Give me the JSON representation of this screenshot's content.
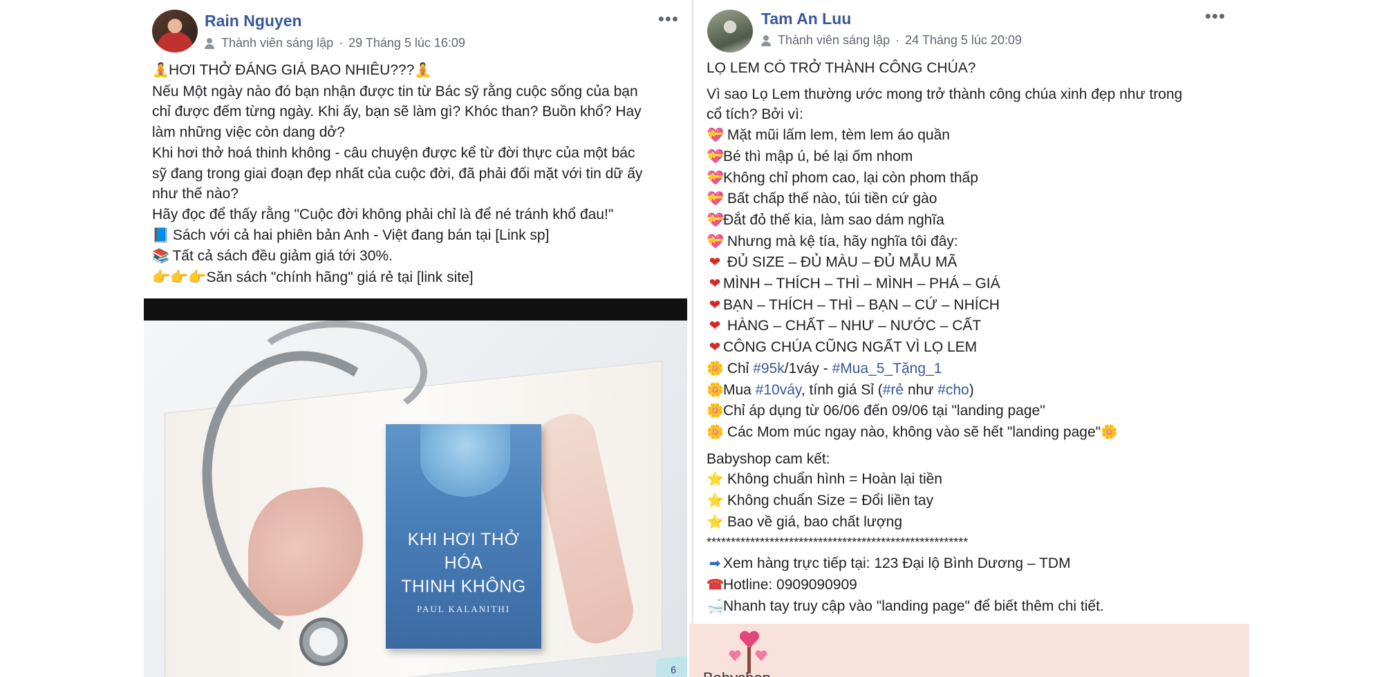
{
  "post1": {
    "author": "Rain Nguyen",
    "role": "Thành viên sáng lập",
    "separator": "·",
    "time": "29 Tháng 5 lúc 16:09",
    "more": "•••",
    "lines": [
      {
        "emoji_left": "🧘",
        "text": "HƠI THỞ ĐÁNG GIÁ BAO NHIÊU???",
        "emoji_right": "🧘"
      },
      {
        "text": "Nếu Một ngày nào đó bạn nhận được tin từ Bác sỹ rằng cuộc sống của bạn"
      },
      {
        "text": "chỉ được đếm từng ngày. Khi ấy, bạn sẽ làm gì? Khóc than? Buồn khổ? Hay"
      },
      {
        "text": "làm những việc còn dang dở?"
      },
      {
        "text": "Khi hơi thở hoá thinh không - câu chuyện được kể từ đời thực của một bác"
      },
      {
        "text": "sỹ đang trong giai đoạn đẹp nhất của cuộc đời, đã phải đối mặt với tin dữ ấy"
      },
      {
        "text": "như thế nào?"
      },
      {
        "text": "Hãy đọc để thấy rằng \"Cuộc đời không phải chỉ là để né tránh khổ đau!\""
      },
      {
        "emoji_left": "📘",
        "text": " Sách với cả hai phiên bản Anh - Việt đang bán tại [Link sp]"
      },
      {
        "emoji_left": "📚",
        "text": " Tất cả sách đều giảm giá tới 30%."
      },
      {
        "emoji_left": "👉👉👉",
        "text": "Săn sách \"chính hãng\" giá rẻ tại [link site]"
      }
    ],
    "image": {
      "book_title_lines": [
        "KHI HƠI THỞ",
        "HÓA",
        "THINH KHÔNG"
      ],
      "book_author": "PAUL KALANITHI",
      "tab_number": "6"
    }
  },
  "post2": {
    "author": "Tam An Luu",
    "role": "Thành viên sáng lập",
    "separator": "·",
    "time": "24 Tháng 5 lúc 20:09",
    "more": "•••",
    "title": "LỌ LEM CÓ TRỞ THÀNH CÔNG CHÚA?",
    "intro_1": "Vì sao Lọ Lem thường ước mong trở thành công chúa xinh đẹp như trong",
    "intro_2": "cổ tích? Bởi vì:",
    "pink_lines": [
      " Mặt mũi lấm lem, tèm lem áo quần",
      "Bé thì mập ú, bé lại ốm nhom",
      "Không chỉ phom cao, lại còn phom thấp",
      " Bất chấp thế nào, túi tiền cứ gào",
      "Đắt đỏ thế kia, làm sao dám nghĩa",
      " Nhưng mà kệ tía, hãy nghĩa tôi đây:"
    ],
    "red_lines": [
      " ĐỦ SIZE – ĐỦ MÀU – ĐỦ MẪU MÃ",
      "MÌNH – THÍCH – THÌ – MÌNH – PHÁ – GIÁ",
      "BẠN – THÍCH – THÌ – BẠN – CỨ – NHÍCH",
      " HÀNG – CHẤT – NHƯ – NƯỚC – CẤT",
      "CÔNG CHÚA CŨNG NGẤT VÌ LỌ LEM"
    ],
    "promo": {
      "l1_a": " Chỉ ",
      "l1_tag1": "#95k",
      "l1_b": "/1váy - ",
      "l1_tag2": "#Mua_5_Tặng_1",
      "l2_a": "Mua ",
      "l2_tag1": "#10váy",
      "l2_b": ", tính giá Sỉ (",
      "l2_tag2": "#rẻ",
      "l2_c": " như ",
      "l2_tag3": "#cho",
      "l2_d": ")",
      "l3": "Chỉ áp dụng từ 06/06 đến 09/06 tại \"landing page\"",
      "l4": " Các Mom múc ngay nào, không vào sẽ hết \"landing page\""
    },
    "commit_title": "Babyshop cam kết:",
    "commits": [
      " Không chuẩn hình = Hoàn lại tiền",
      " Không chuẩn Size = Đổi liền tay",
      " Bao về giá, bao chất lượng"
    ],
    "stars_line": "******************************************************",
    "contact_address": "Xem hàng trực tiếp tại: 123 Đại lộ Bình Dương – TDM",
    "contact_hotline": "Hotline: 0909090909",
    "contact_landing": "Nhanh tay truy cập vào \"landing page\" để biết thêm chi tiết.",
    "banner_text": "Babyshop"
  },
  "icons": {
    "member": "member-icon",
    "more": "more-icon",
    "pink_heart": "💝",
    "red_heart": "❤",
    "sun": "🌼",
    "star": "⭐",
    "arrow": "➡",
    "phone": "☎",
    "bath": "🛁",
    "colors": {
      "link": "#385898",
      "meta": "#606770",
      "banner": "#f9e1dc"
    }
  }
}
